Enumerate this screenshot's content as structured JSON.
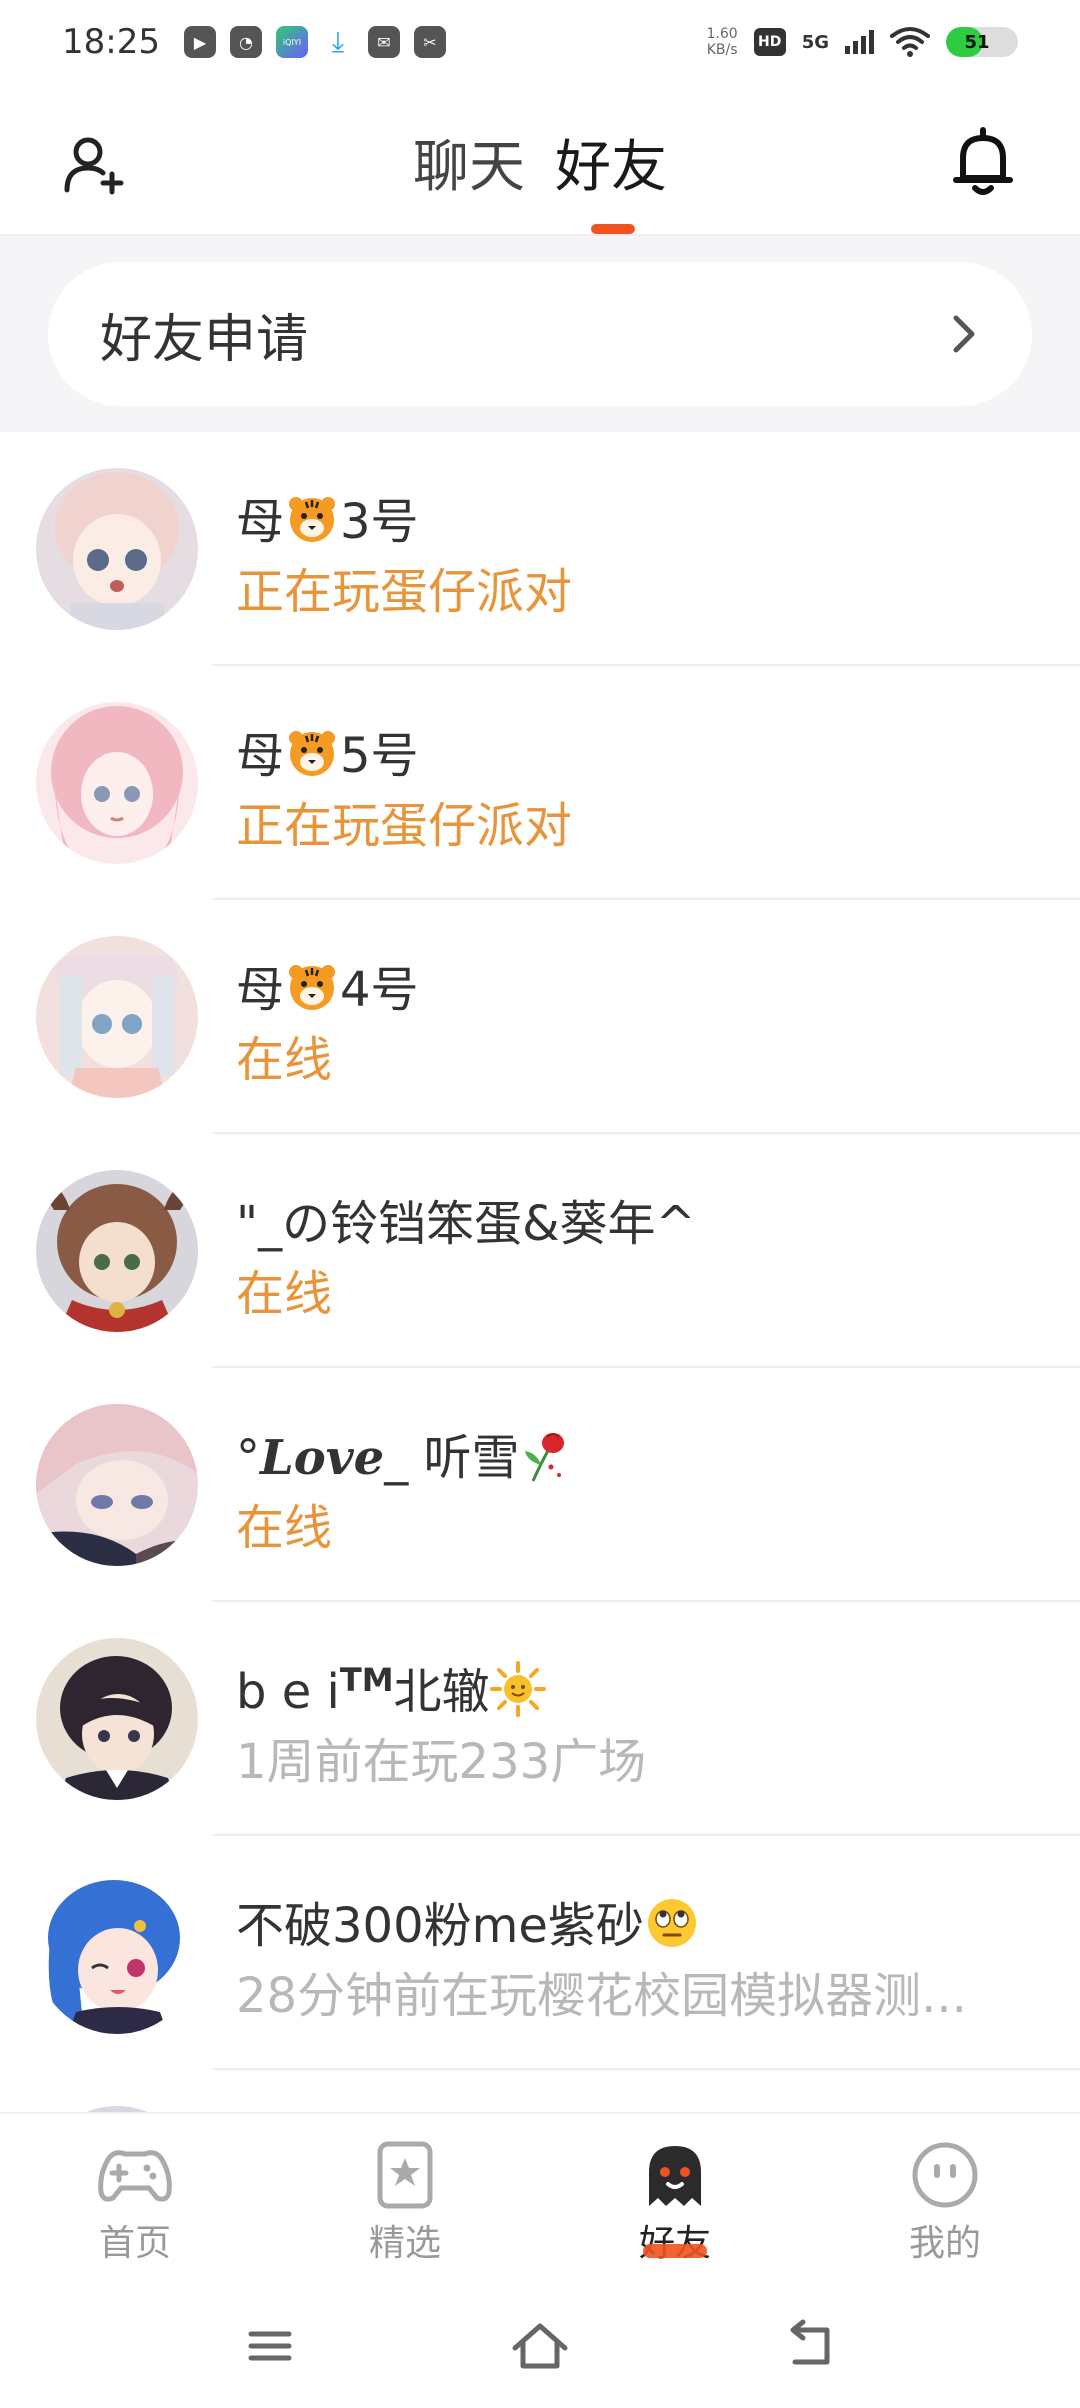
{
  "status_bar": {
    "time": "18:25",
    "net_speed_value": "1.60",
    "net_speed_unit": "KB/s",
    "hd": "HD",
    "network": "5G",
    "battery": "51",
    "battery_level_percent": 51
  },
  "header": {
    "tabs": [
      {
        "label": "聊天",
        "active": false
      },
      {
        "label": "好友",
        "active": true
      }
    ]
  },
  "friend_request": {
    "label": "好友申请"
  },
  "friends": [
    {
      "name_prefix": "母",
      "emoji": "tiger",
      "name_suffix": "3号",
      "status": "正在玩蛋仔派对",
      "status_type": "online",
      "avatar_color": "#d9c7cf"
    },
    {
      "name_prefix": "母",
      "emoji": "tiger",
      "name_suffix": "5号",
      "status": "正在玩蛋仔派对",
      "status_type": "online",
      "avatar_color": "#f2c4cc"
    },
    {
      "name_prefix": "母",
      "emoji": "tiger",
      "name_suffix": "4号",
      "status": "在线",
      "status_type": "online",
      "avatar_color": "#e8d4d2"
    },
    {
      "name_prefix": "\"_の铃铛笨蛋&葵年^",
      "emoji": "",
      "name_suffix": "",
      "status": "在线",
      "status_type": "online",
      "avatar_color": "#c9b5a7"
    },
    {
      "name_prefix": "°",
      "name_script": "Love",
      "name_suffix": "_ 听雪",
      "emoji": "rose",
      "status": "在线",
      "status_type": "online",
      "avatar_color": "#e4ccd0"
    },
    {
      "name_prefix": "b e i",
      "name_sup": "TM",
      "name_suffix": "北辙",
      "emoji": "sun",
      "status": "1周前在玩233广场",
      "status_type": "offline",
      "avatar_color": "#3a3340"
    },
    {
      "name_prefix": "不破300粉me紫砂",
      "emoji": "eyeroll",
      "name_suffix": "",
      "status": "28分钟前在玩樱花校园模拟器测...",
      "status_type": "offline",
      "avatar_color": "#3f74d6"
    }
  ],
  "bottom_nav": [
    {
      "label": "首页",
      "icon": "gamepad-icon",
      "active": false
    },
    {
      "label": "精选",
      "icon": "star-bookmark-icon",
      "active": false
    },
    {
      "label": "好友",
      "icon": "ghost-icon",
      "active": true
    },
    {
      "label": "我的",
      "icon": "smiley-icon",
      "active": false
    }
  ],
  "system_nav": [
    "menu-icon",
    "home-icon",
    "back-icon"
  ],
  "colors": {
    "accent": "#f0531f",
    "online": "#e8943a",
    "offline": "#b8b8b8"
  }
}
